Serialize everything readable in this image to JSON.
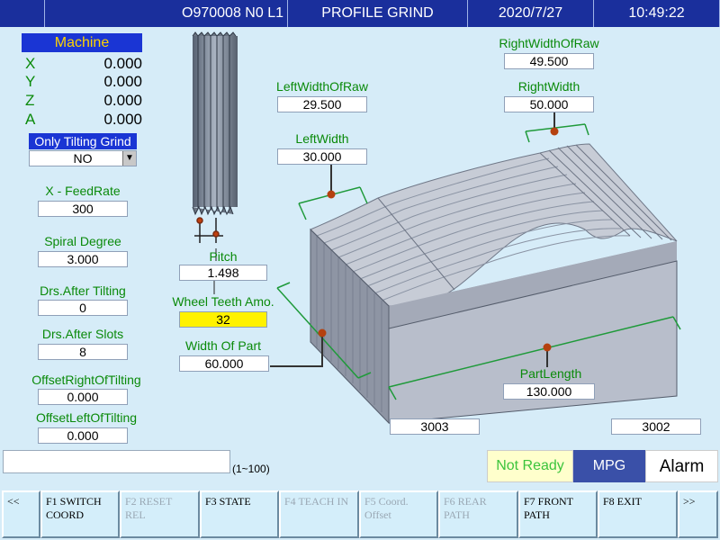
{
  "header": {
    "blank": "",
    "program": "O970008 N0 L1",
    "mode": "PROFILE GRIND",
    "date": "2020/7/27",
    "time": "10:49:22"
  },
  "machine": {
    "title": "Machine",
    "axes": [
      {
        "name": "X",
        "value": "0.000"
      },
      {
        "name": "Y",
        "value": "0.000"
      },
      {
        "name": "Z",
        "value": "0.000"
      },
      {
        "name": "A",
        "value": "0.000"
      }
    ]
  },
  "tilting": {
    "label": "Only Tilting Grind",
    "value": "NO"
  },
  "params_left": [
    {
      "label": "X - FeedRate",
      "value": "300"
    },
    {
      "label": "Spiral Degree",
      "value": "3.000"
    },
    {
      "label": "Drs.After Tilting",
      "value": "0"
    },
    {
      "label": "Drs.After Slots",
      "value": "8"
    },
    {
      "label": "OffsetRightOfTilting",
      "value": "0.000"
    },
    {
      "label": "OffsetLeftOfTilting",
      "value": "0.000"
    }
  ],
  "wheel": {
    "pitch_label": "Pitch",
    "pitch_value": "1.498",
    "teeth_label": "Wheel Teeth Amo.",
    "teeth_value": "32",
    "width_label": "Width Of Part",
    "width_value": "60.000"
  },
  "part": {
    "left_raw_label": "LeftWidthOfRaw",
    "left_raw_value": "29.500",
    "left_width_label": "LeftWidth",
    "left_width_value": "30.000",
    "right_raw_label": "RightWidthOfRaw",
    "right_raw_value": "49.500",
    "right_width_label": "RightWidth",
    "right_width_value": "50.000",
    "length_label": "PartLength",
    "length_value": "130.000",
    "code_left": "3003",
    "code_right": "3002"
  },
  "status": {
    "range": "(1~100)",
    "not_ready": "Not Ready",
    "mpg": "MPG",
    "alarm": "Alarm"
  },
  "fkeys": [
    {
      "label": "<<",
      "enabled": true
    },
    {
      "label": "F1 SWITCH COORD",
      "enabled": true
    },
    {
      "label": "F2 RESET REL",
      "enabled": false
    },
    {
      "label": "F3 STATE",
      "enabled": true
    },
    {
      "label": "F4 TEACH IN",
      "enabled": false
    },
    {
      "label": "F5 Coord. Offset",
      "enabled": false
    },
    {
      "label": "F6 REAR PATH",
      "enabled": false
    },
    {
      "label": "F7 FRONT PATH",
      "enabled": true
    },
    {
      "label": "F8 EXIT",
      "enabled": true
    },
    {
      "label": ">>",
      "enabled": true
    }
  ]
}
